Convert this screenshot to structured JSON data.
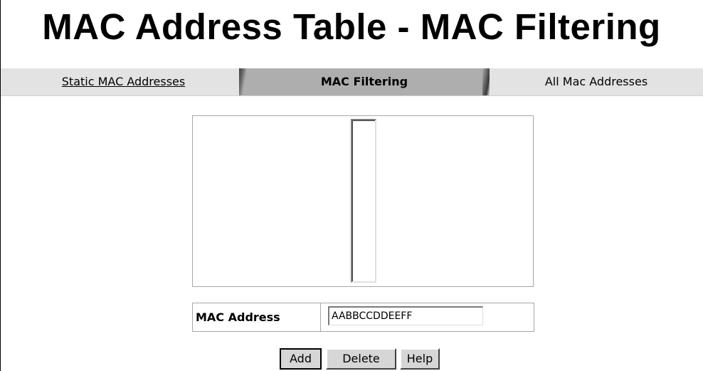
{
  "page_title": "MAC Address Table - MAC Filtering",
  "tabs": [
    {
      "label": "Static MAC Addresses",
      "state": "link"
    },
    {
      "label": "MAC Filtering",
      "state": "active"
    },
    {
      "label": "All Mac Addresses",
      "state": "inactive"
    }
  ],
  "mac_list": {
    "items": []
  },
  "form": {
    "mac_label": "MAC Address",
    "mac_value": "AABBCCDDEEFF"
  },
  "buttons": {
    "add": "Add",
    "delete": "Delete",
    "help": "Help"
  },
  "colors": {
    "active_tab": "#aeaeae",
    "inactive_tab": "#e3e3e3",
    "button_face": "#d6d6d6"
  }
}
